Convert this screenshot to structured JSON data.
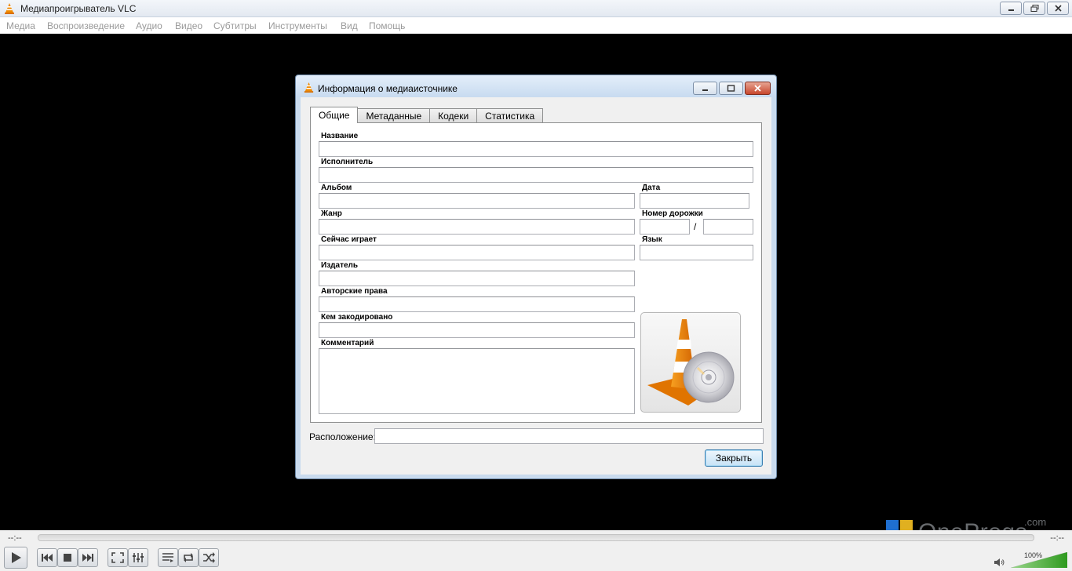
{
  "window": {
    "title": "Медиапроигрыватель VLC",
    "icons": {
      "app": "vlc-cone-icon",
      "minimize": "minimize-icon",
      "restore": "restore-icon",
      "close": "close-icon"
    }
  },
  "menu": [
    "Медиа",
    "Воспроизведение",
    "Аудио",
    "Видео",
    "Субтитры",
    "Инструменты",
    "Вид",
    "Помощь"
  ],
  "dialog": {
    "title": "Информация о медиаисточнике",
    "tabs": [
      "Общие",
      "Метаданные",
      "Кодеки",
      "Статистика"
    ],
    "active_tab": "Общие",
    "fields": {
      "title": {
        "label": "Название",
        "value": ""
      },
      "artist": {
        "label": "Исполнитель",
        "value": ""
      },
      "album": {
        "label": "Альбом",
        "value": ""
      },
      "date": {
        "label": "Дата",
        "value": ""
      },
      "genre": {
        "label": "Жанр",
        "value": ""
      },
      "track_number": {
        "label": "Номер дорожки",
        "value": "",
        "total": "",
        "separator": "/"
      },
      "now_playing": {
        "label": "Сейчас играет",
        "value": ""
      },
      "language": {
        "label": "Язык",
        "value": ""
      },
      "publisher": {
        "label": "Издатель",
        "value": ""
      },
      "copyright": {
        "label": "Авторские права",
        "value": ""
      },
      "encoded_by": {
        "label": "Кем закодировано",
        "value": ""
      },
      "comment": {
        "label": "Комментарий",
        "value": ""
      }
    },
    "location": {
      "label": "Расположение:",
      "value": ""
    },
    "close_button": "Закрыть",
    "art": "vlc-cone-disc-art"
  },
  "controls": {
    "time_elapsed": "--:--",
    "time_total": "--:--",
    "volume_percent": "100%",
    "volume_level": 1.0,
    "buttons": [
      "play-icon",
      "previous-icon",
      "stop-icon",
      "next-icon",
      "fullscreen-icon",
      "extended-settings-icon",
      "playlist-icon",
      "loop-icon",
      "shuffle-icon"
    ]
  },
  "watermark": {
    "text": "OneProgs",
    "suffix": ".com"
  },
  "colors": {
    "accent": "#3a9c2f",
    "vlc_orange": "#f08a00",
    "close_red": "#c7462c"
  }
}
